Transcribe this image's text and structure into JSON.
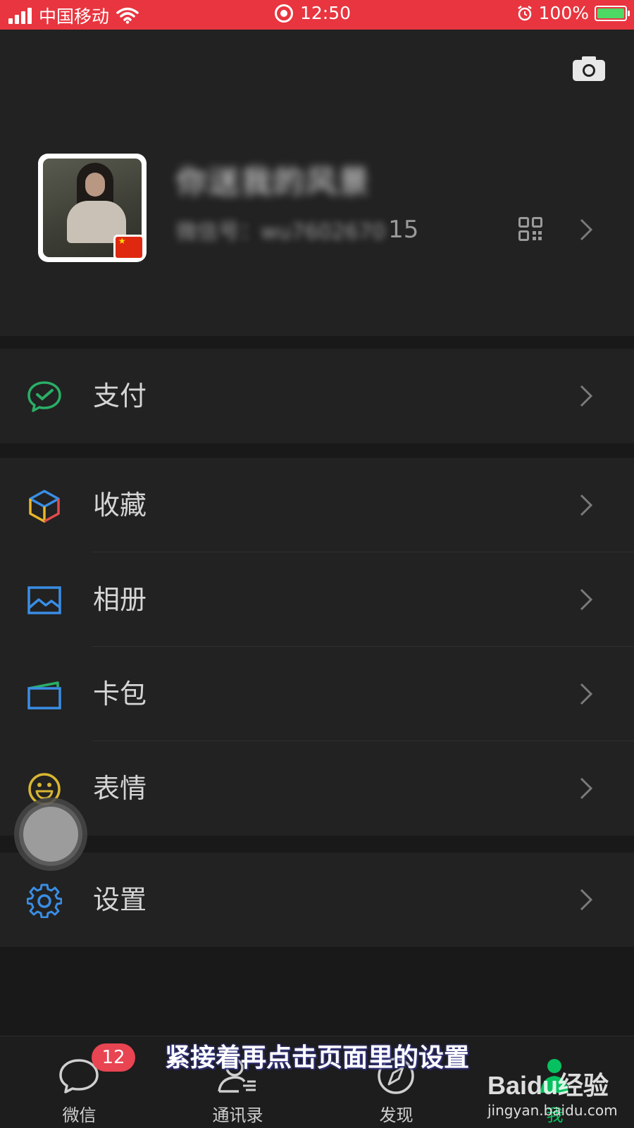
{
  "status_bar": {
    "carrier": "中国移动",
    "time": "12:50",
    "battery_percent": "100%",
    "background_color": "#e8353f"
  },
  "profile": {
    "nickname": "你送我的风景",
    "wechat_id_blurred": "微信号：wu7602670",
    "wechat_id_tail": "15",
    "icons": [
      "camera-icon",
      "qr-code-icon",
      "chevron-right-icon"
    ]
  },
  "menu": {
    "pay": {
      "label": "支付",
      "icon": "wechat-pay-icon",
      "color": "#2aae67"
    },
    "favorites": {
      "label": "收藏",
      "icon": "cube-icon"
    },
    "album": {
      "label": "相册",
      "icon": "picture-icon",
      "color": "#3a8ee6"
    },
    "cards": {
      "label": "卡包",
      "icon": "card-wallet-icon",
      "color": "#3a8ee6"
    },
    "stickers": {
      "label": "表情",
      "icon": "smiley-icon",
      "color": "#d9b632"
    },
    "settings": {
      "label": "设置",
      "icon": "gear-icon",
      "color": "#3a8ee6"
    }
  },
  "tabbar": {
    "chats": {
      "label": "微信",
      "badge": "12"
    },
    "contacts": {
      "label": "通讯录"
    },
    "discover": {
      "label": "发现"
    },
    "me": {
      "label": "我",
      "active": true,
      "color": "#07c160"
    }
  },
  "subtitle": "紧接着再点击页面里的设置",
  "watermark": {
    "brand": "Baidu经验",
    "url": "jingyan.baidu.com"
  }
}
